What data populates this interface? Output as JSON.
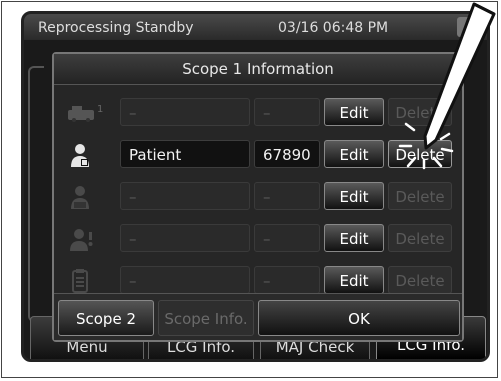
{
  "statusbar": {
    "title": "Reprocessing Standby",
    "time": "03/16 06:48 PM"
  },
  "background_tabs": [
    "Menu",
    "LCG Info.",
    "MAJ Check",
    "LCG Info."
  ],
  "dialog": {
    "title": "Scope 1 Information",
    "rows": [
      {
        "icon": "scope-icon",
        "name": "–",
        "id": "–",
        "edit": "Edit",
        "delete": "Delete",
        "active": false
      },
      {
        "icon": "patient-icon",
        "name": "Patient",
        "id": "67890",
        "edit": "Edit",
        "delete": "Delete",
        "active": true
      },
      {
        "icon": "operator-icon",
        "name": "–",
        "id": "–",
        "edit": "Edit",
        "delete": "Delete",
        "active": false
      },
      {
        "icon": "staff-icon",
        "name": "–",
        "id": "–",
        "edit": "Edit",
        "delete": "Delete",
        "active": false
      },
      {
        "icon": "clipboard-icon",
        "name": "–",
        "id": "–",
        "edit": "Edit",
        "delete": "Delete",
        "active": false
      }
    ],
    "footer": {
      "scope2": "Scope 2",
      "scope_info": "Scope Info.",
      "ok": "OK"
    }
  },
  "colors": {
    "screen_bg": "#1a1a1a",
    "dialog_bg": "#262626",
    "active_text": "#f2f2f2",
    "disabled_text": "#5a5a5a"
  }
}
